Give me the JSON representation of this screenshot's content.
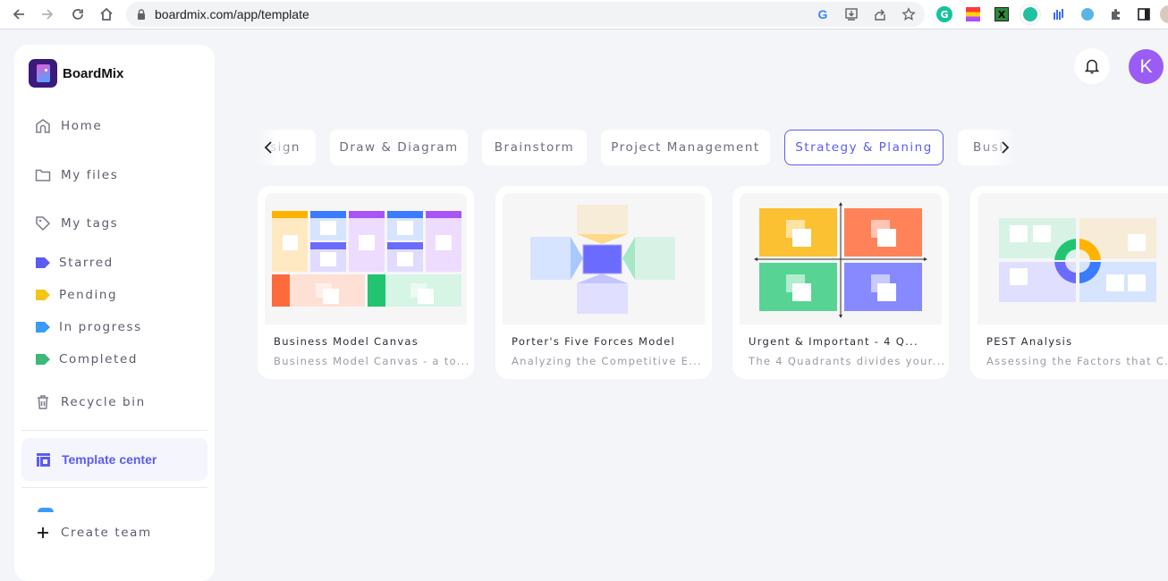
{
  "browser": {
    "url": "boardmix.com/app/template",
    "nav": [
      "back",
      "forward",
      "reload",
      "home"
    ]
  },
  "sidebar": {
    "brand": "BoardMix",
    "items": [
      {
        "label": "Home",
        "icon": "home-icon"
      },
      {
        "label": "My files",
        "icon": "folder-icon"
      },
      {
        "label": "My tags",
        "icon": "tag-icon"
      }
    ],
    "tags": [
      {
        "label": "Starred",
        "color": "#5b5cf0"
      },
      {
        "label": "Pending",
        "color": "#f5c518"
      },
      {
        "label": "In progress",
        "color": "#3a9bfa"
      },
      {
        "label": "Completed",
        "color": "#3cb878"
      }
    ],
    "recycle": "Recycle bin",
    "template_center": "Template center",
    "create_team": "Create team"
  },
  "header": {
    "avatar_initial": "K"
  },
  "categories": {
    "items": [
      "sign",
      "Draw & Diagram",
      "Brainstorm",
      "Project Management",
      "Strategy & Planing",
      "Busi"
    ],
    "active": "Strategy & Planing"
  },
  "templates": [
    {
      "title": "Business Model Canvas",
      "desc": "Business Model Canvas - a to..."
    },
    {
      "title": "Porter's Five Forces Model",
      "desc": "Analyzing the Competitive E..."
    },
    {
      "title": "Urgent & Important - 4 Q...",
      "desc": "The 4 Quadrants divides your..."
    },
    {
      "title": "PEST Analysis",
      "desc": "Assessing the Factors that C..."
    }
  ],
  "colors": {
    "accent": "#5b5cf0",
    "avatar": "#9b5cf6"
  }
}
